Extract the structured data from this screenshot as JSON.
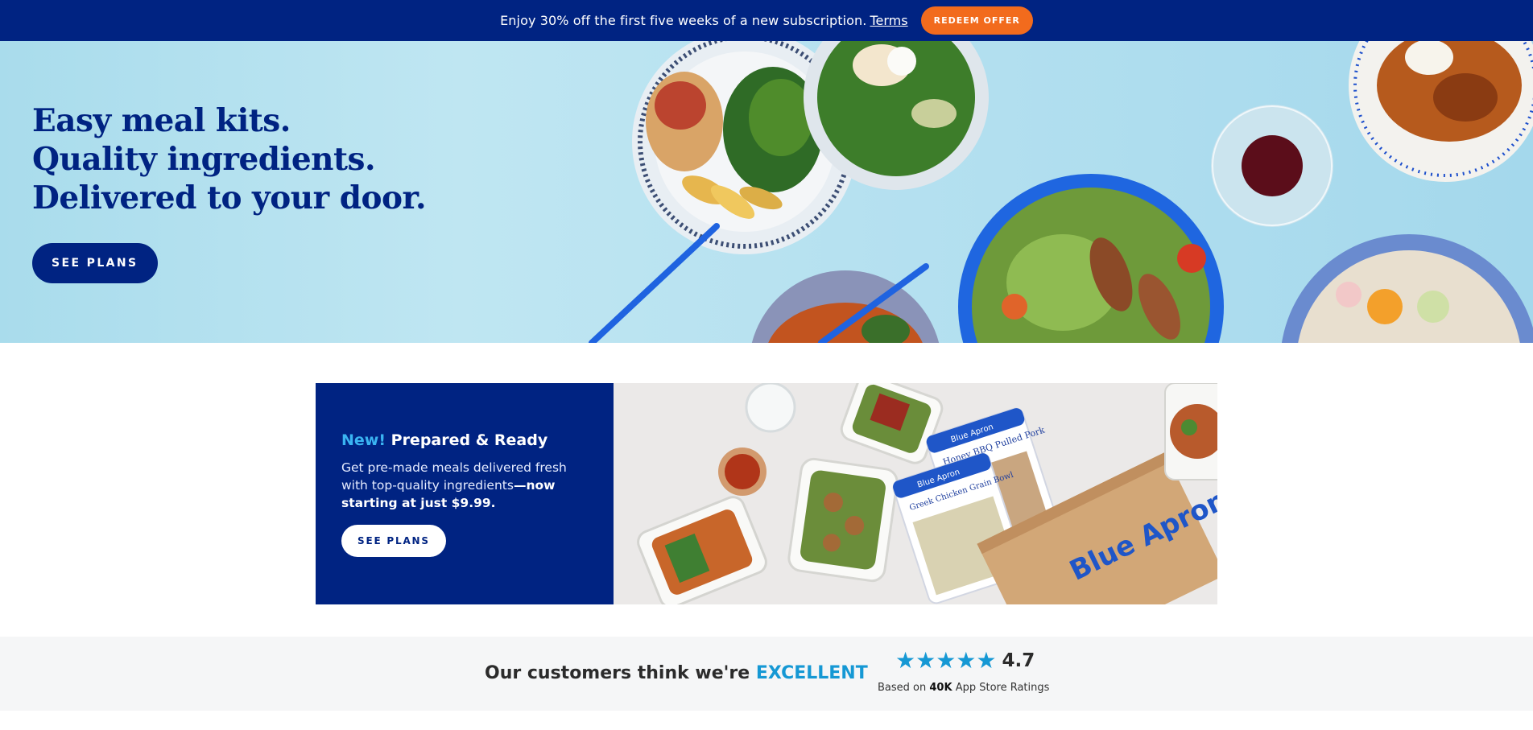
{
  "promo": {
    "text": "Enjoy 30% off the first five weeks of a new subscription.",
    "terms_label": "Terms",
    "redeem_label": "REDEEM OFFER"
  },
  "hero": {
    "headline_lines": [
      "Easy meal kits.",
      "Quality ingredients.",
      "Delivered to your door."
    ],
    "cta_label": "SEE PLANS"
  },
  "prepared": {
    "new_tag": "New!",
    "title": "Prepared & Ready",
    "desc": "Get pre-made meals delivered fresh with top-quality ingredients",
    "desc_bold": "—now starting at just $9.99.",
    "cta_label": "SEE PLANS",
    "package_brand": "Blue Apron",
    "package_labels": [
      "Honey BBQ Pulled Pork",
      "Greek Chicken Grain Bowl"
    ]
  },
  "ratings": {
    "heading_prefix": "Our customers think we're",
    "heading_highlight": "EXCELLENT",
    "stars": "★★★★★",
    "score": "4.7",
    "based_prefix": "Based on",
    "based_count": "40K",
    "based_suffix": "App Store Ratings"
  },
  "colors": {
    "brand_navy": "#002382",
    "accent_orange": "#f26b1d",
    "accent_blue": "#1598d4",
    "hero_bg": "#b6e1f0"
  }
}
